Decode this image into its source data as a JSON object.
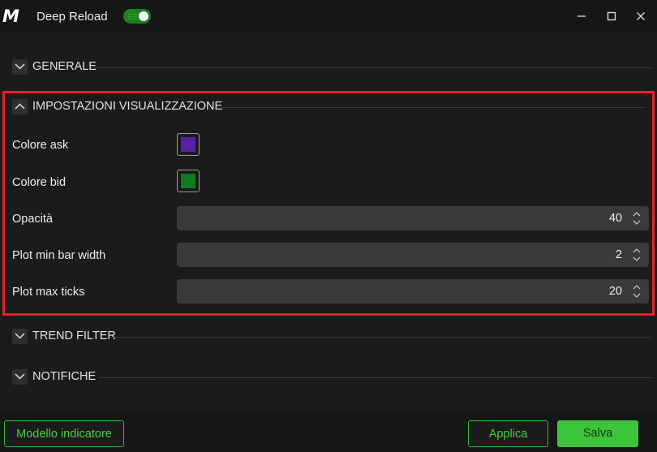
{
  "titlebar": {
    "logo": "M",
    "title": "Deep Reload",
    "toggle_on": true,
    "minimize": "—",
    "maximize": "☐",
    "close": "✕"
  },
  "sections": {
    "general": {
      "label": "GENERALE",
      "expanded": false
    },
    "display": {
      "label": "IMPOSTAZIONI VISUALIZZAZIONE",
      "expanded": true
    },
    "trend": {
      "label": "TREND FILTER",
      "expanded": false
    },
    "notifications": {
      "label": "NOTIFICHE",
      "expanded": false
    }
  },
  "settings": {
    "ask_color": {
      "label": "Colore ask",
      "color": "#5c1fa8"
    },
    "bid_color": {
      "label": "Colore bid",
      "color": "#0f7a1f"
    },
    "opacity": {
      "label": "Opacità",
      "value": "40"
    },
    "min_bar_width": {
      "label": "Plot min bar width",
      "value": "2"
    },
    "max_ticks": {
      "label": "Plot max ticks",
      "value": "20"
    }
  },
  "footer": {
    "template_button": "Modello indicatore",
    "apply_button": "Applica",
    "save_button": "Salva"
  },
  "colors": {
    "accent": "#3cc43c",
    "highlight_border": "#e8202b"
  }
}
